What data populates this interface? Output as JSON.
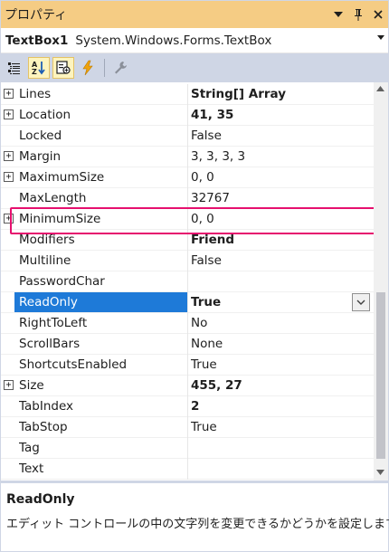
{
  "window": {
    "title": "プロパティ",
    "buttons": [
      "dropdown-arrow",
      "pin",
      "close"
    ]
  },
  "object_selector": {
    "name": "TextBox1",
    "type": "System.Windows.Forms.TextBox"
  },
  "toolbar": {
    "buttons": [
      {
        "name": "categorized-icon"
      },
      {
        "name": "alphabetical-icon",
        "active": true
      },
      {
        "name": "properties-icon",
        "active": true
      },
      {
        "name": "events-icon"
      },
      {
        "name": "property-pages-icon"
      }
    ]
  },
  "grid": {
    "rows": [
      {
        "name": "Lines",
        "value": "String[] Array",
        "bold": true,
        "expandable": true
      },
      {
        "name": "Location",
        "value": "41, 35",
        "bold": true,
        "expandable": true
      },
      {
        "name": "Locked",
        "value": "False",
        "bold": false,
        "expandable": false
      },
      {
        "name": "Margin",
        "value": "3, 3, 3, 3",
        "bold": false,
        "expandable": true
      },
      {
        "name": "MaximumSize",
        "value": "0, 0",
        "bold": false,
        "expandable": true
      },
      {
        "name": "MaxLength",
        "value": "32767",
        "bold": false,
        "expandable": false
      },
      {
        "name": "MinimumSize",
        "value": "0, 0",
        "bold": false,
        "expandable": true
      },
      {
        "name": "Modifiers",
        "value": "Friend",
        "bold": true,
        "expandable": false
      },
      {
        "name": "Multiline",
        "value": "False",
        "bold": false,
        "expandable": false
      },
      {
        "name": "PasswordChar",
        "value": "",
        "bold": false,
        "expandable": false
      },
      {
        "name": "ReadOnly",
        "value": "True",
        "bold": true,
        "expandable": false,
        "selected": true
      },
      {
        "name": "RightToLeft",
        "value": "No",
        "bold": false,
        "expandable": false
      },
      {
        "name": "ScrollBars",
        "value": "None",
        "bold": false,
        "expandable": false
      },
      {
        "name": "ShortcutsEnabled",
        "value": "True",
        "bold": false,
        "expandable": false
      },
      {
        "name": "Size",
        "value": "455, 27",
        "bold": true,
        "expandable": true
      },
      {
        "name": "TabIndex",
        "value": "2",
        "bold": true,
        "expandable": false
      },
      {
        "name": "TabStop",
        "value": "True",
        "bold": false,
        "expandable": false
      },
      {
        "name": "Tag",
        "value": "",
        "bold": false,
        "expandable": false
      },
      {
        "name": "Text",
        "value": "",
        "bold": false,
        "expandable": false
      }
    ],
    "expand_glyph": "+"
  },
  "description": {
    "title": "ReadOnly",
    "text": "エディット コントロールの中の文字列を変更できるかどうかを設定します。"
  },
  "colors": {
    "titlebar": "#f5cc84",
    "toolbar": "#cfd6e5",
    "selection": "#1e7ad8",
    "highlight_border": "#e6106e"
  }
}
